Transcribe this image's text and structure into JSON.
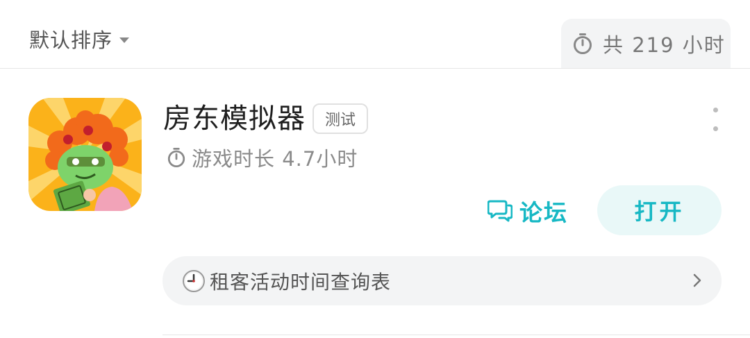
{
  "sort": {
    "label": "默认排序"
  },
  "summary": {
    "total_time": "共 219 小时"
  },
  "game": {
    "title": "房东模拟器",
    "badge": "测试",
    "playtime": "游戏时长 4.7小时",
    "icon": "landlord-simulator-app-icon"
  },
  "actions": {
    "forum_label": "论坛",
    "open_label": "打开"
  },
  "link_row": {
    "text": "租客活动时间查询表",
    "emoji": "🕙"
  },
  "icons": {
    "timer": "stopwatch-icon",
    "forum": "chat-bubbles-icon",
    "chevron": "chevron-right-icon",
    "more": "more-vertical-icon",
    "sort_caret": "caret-down-icon"
  },
  "colors": {
    "accent": "#17b8c4",
    "accent_bg": "#e9f8f8",
    "muted_bg": "#f3f4f5",
    "icon_bg": "#fbb21a"
  }
}
